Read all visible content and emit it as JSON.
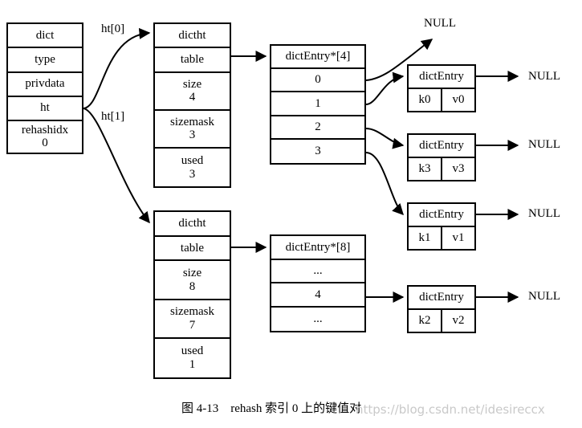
{
  "figure": {
    "caption": "图 4-13　rehash 索引 0 上的键值对",
    "watermark": "https://blog.csdn.net/idesireccx",
    "line_color": "#000000",
    "background": "#ffffff"
  },
  "dict": {
    "title": "dict",
    "fields": [
      {
        "name": "type",
        "value": ""
      },
      {
        "name": "privdata",
        "value": ""
      },
      {
        "name": "ht",
        "value": ""
      },
      {
        "name": "rehashidx",
        "value": "0"
      }
    ]
  },
  "pointer_labels": {
    "ht0": "ht[0]",
    "ht1": "ht[1]"
  },
  "ht0": {
    "title": "dictht",
    "table_label": "table",
    "size_label": "size",
    "size_value": "4",
    "sizemask_label": "sizemask",
    "sizemask_value": "3",
    "used_label": "used",
    "used_value": "3",
    "bucket_array": {
      "title": "dictEntry*[4]",
      "slots": [
        "0",
        "1",
        "2",
        "3"
      ]
    }
  },
  "ht1": {
    "title": "dictht",
    "table_label": "table",
    "size_label": "size",
    "size_value": "8",
    "sizemask_label": "sizemask",
    "sizemask_value": "7",
    "used_label": "used",
    "used_value": "1",
    "bucket_array": {
      "title": "dictEntry*[8]",
      "slots": [
        "...",
        "4",
        "..."
      ]
    }
  },
  "entries": [
    {
      "title": "dictEntry",
      "key": "k0",
      "value": "v0",
      "next": "NULL"
    },
    {
      "title": "dictEntry",
      "key": "k3",
      "value": "v3",
      "next": "NULL"
    },
    {
      "title": "dictEntry",
      "key": "k1",
      "value": "v1",
      "next": "NULL"
    },
    {
      "title": "dictEntry",
      "key": "k2",
      "value": "v2",
      "next": "NULL"
    }
  ],
  "null_labels": {
    "slot0": "NULL",
    "entry0": "NULL",
    "entry1": "NULL",
    "entry2": "NULL",
    "entry3": "NULL"
  }
}
